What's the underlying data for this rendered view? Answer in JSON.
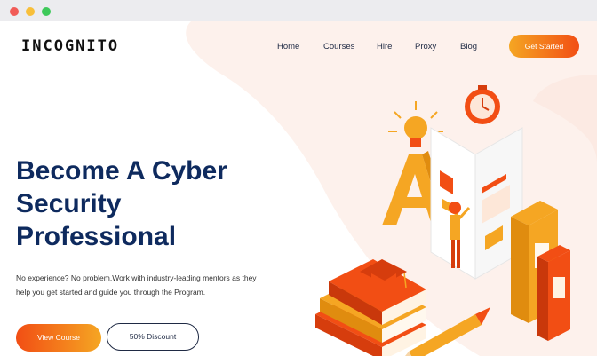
{
  "window": {
    "controls": [
      "close",
      "minimize",
      "maximize"
    ]
  },
  "brand": {
    "logo": "INCOGNITO"
  },
  "nav": {
    "items": [
      {
        "label": "Home"
      },
      {
        "label": "Courses"
      },
      {
        "label": "Hire"
      },
      {
        "label": "Proxy"
      },
      {
        "label": "Blog"
      }
    ],
    "cta_label": "Get Started"
  },
  "hero": {
    "title_lines": [
      "Become A Cyber",
      "Security",
      "Professional"
    ],
    "subtitle_lines": [
      "No experience? No problem.Work with industry-leading mentors as they",
      "help you get started and guide you through the Program."
    ],
    "primary_button": "View Course",
    "secondary_button": "50% Discount"
  },
  "illustration": {
    "letter": "A",
    "icons": [
      "lightbulb-icon",
      "clock-icon",
      "graduation-cap-icon",
      "books-icon",
      "pencil-icon",
      "person-figure"
    ]
  },
  "colors": {
    "accent_orange": "#f24e14",
    "accent_yellow": "#f5a623",
    "heading_navy": "#0e2a5e",
    "blob_pink": "#fdf1ec"
  }
}
